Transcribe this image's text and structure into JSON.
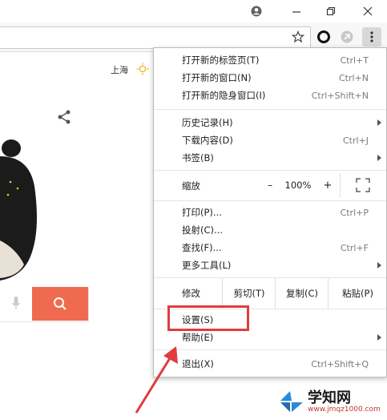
{
  "location": "上海",
  "menu": {
    "items": [
      {
        "label": "打开新的标签页(T)",
        "shortcut": "Ctrl+T"
      },
      {
        "label": "打开新的窗口(N)",
        "shortcut": "Ctrl+N"
      },
      {
        "label": "打开新的隐身窗口(I)",
        "shortcut": "Ctrl+Shift+N"
      },
      {
        "label": "历史记录(H)",
        "shortcut": ""
      },
      {
        "label": "下载内容(D)",
        "shortcut": "Ctrl+J"
      },
      {
        "label": "书签(B)",
        "shortcut": ""
      },
      {
        "label": "打印(P)...",
        "shortcut": "Ctrl+P"
      },
      {
        "label": "投射(C)...",
        "shortcut": ""
      },
      {
        "label": "查找(F)...",
        "shortcut": "Ctrl+F"
      },
      {
        "label": "更多工具(L)",
        "shortcut": ""
      },
      {
        "label": "设置(S)",
        "shortcut": ""
      },
      {
        "label": "帮助(E)",
        "shortcut": ""
      },
      {
        "label": "退出(X)",
        "shortcut": "Ctrl+Shift+Q"
      }
    ],
    "zoom": {
      "label": "缩放",
      "minus": "–",
      "value": "100%",
      "plus": "+"
    },
    "edit": {
      "label": "修改",
      "cut": "剪切(T)",
      "copy": "复制(C)",
      "paste": "粘贴(P)"
    }
  },
  "watermark": {
    "brand": "学知网",
    "url": "www.jmqz1000.com"
  },
  "colors": {
    "highlight": "#e03c3c",
    "search_button": "#f06a4f",
    "arrow": "#e03c3c"
  }
}
